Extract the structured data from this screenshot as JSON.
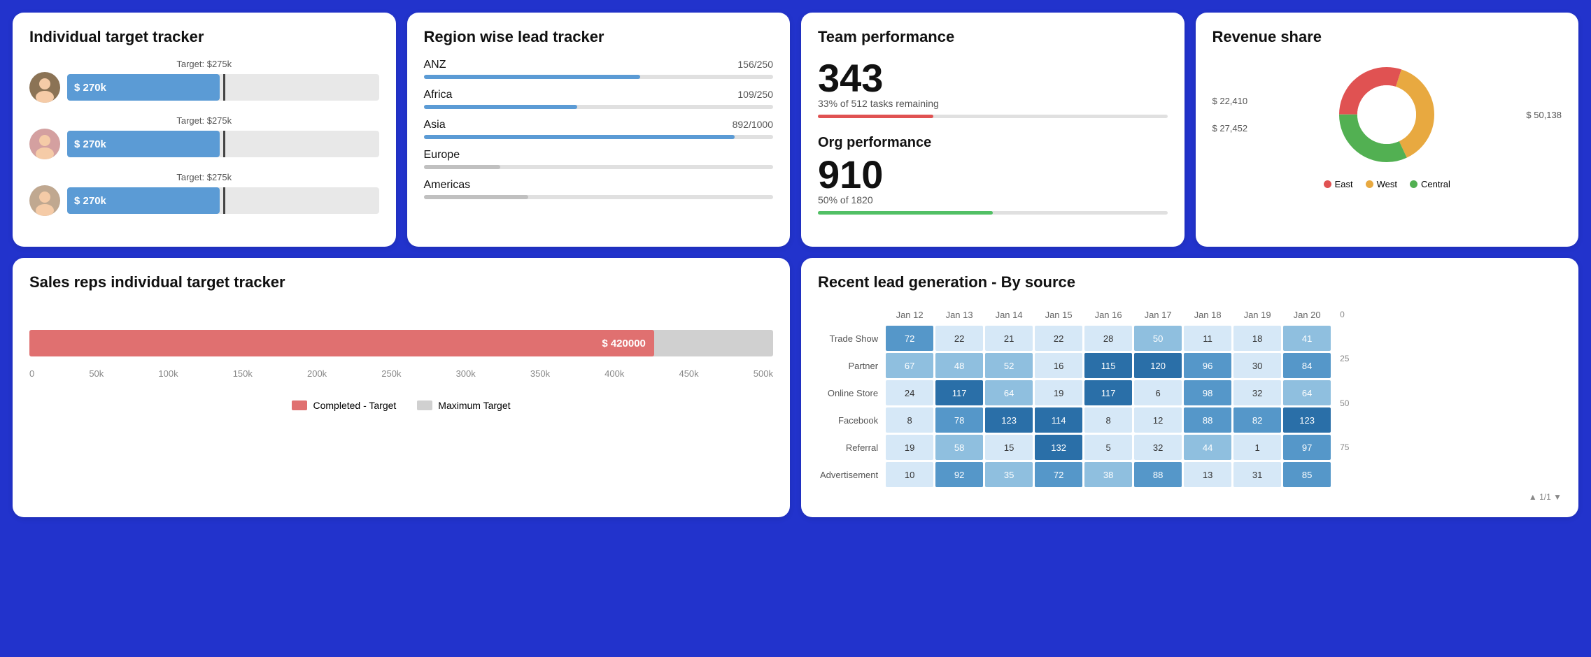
{
  "cards": {
    "individual_tracker": {
      "title": "Individual target tracker",
      "people": [
        {
          "id": 1,
          "label": "Target: $275k",
          "value": "$ 270k",
          "fill_pct": 49,
          "target_pct": 50
        },
        {
          "id": 2,
          "label": "Target: $275k",
          "value": "$ 270k",
          "fill_pct": 49,
          "target_pct": 50
        },
        {
          "id": 3,
          "label": "Target: $275k",
          "value": "$ 270k",
          "fill_pct": 49,
          "target_pct": 50
        }
      ]
    },
    "region_tracker": {
      "title": "Region wise lead tracker",
      "regions": [
        {
          "name": "ANZ",
          "current": 156,
          "total": 250,
          "pct": 62
        },
        {
          "name": "Africa",
          "current": 109,
          "total": 250,
          "pct": 44
        },
        {
          "name": "Asia",
          "current": 892,
          "total": 1000,
          "pct": 89
        },
        {
          "name": "Europe",
          "current": null,
          "total": null,
          "pct": 22
        },
        {
          "name": "Americas",
          "current": null,
          "total": null,
          "pct": 30
        }
      ]
    },
    "team_performance": {
      "title": "Team performance",
      "team_value": "343",
      "team_sub": "33% of 512 tasks remaining",
      "team_pct": 33,
      "org_title": "Org performance",
      "org_value": "910",
      "org_sub": "50% of 1820",
      "org_pct": 50
    },
    "revenue_share": {
      "title": "Revenue share",
      "labels_left": [
        "$ 22,410",
        "$ 27,452"
      ],
      "labels_right": [
        "$ 50,138"
      ],
      "segments": [
        {
          "label": "East",
          "color": "#e05252",
          "pct": 30
        },
        {
          "label": "West",
          "color": "#e8a940",
          "pct": 38
        },
        {
          "label": "Central",
          "color": "#52b052",
          "pct": 32
        }
      ]
    },
    "sales_tracker": {
      "title": "Sales reps individual target tracker",
      "bar_value": "$ 420000",
      "bar_fill_pct": 84,
      "axis_labels": [
        "0",
        "50k",
        "100k",
        "150k",
        "200k",
        "250k",
        "300k",
        "350k",
        "400k",
        "450k",
        "500k"
      ],
      "legend": [
        {
          "label": "Completed - Target",
          "color": "#e07070"
        },
        {
          "label": "Maximum Target",
          "color": "#d0d0d0"
        }
      ]
    },
    "lead_generation": {
      "title": "Recent lead generation - By source",
      "columns": [
        "Jan 12",
        "Jan 13",
        "Jan 14",
        "Jan 15",
        "Jan 16",
        "Jan 17",
        "Jan 18",
        "Jan 19",
        "Jan 20"
      ],
      "rows": [
        {
          "label": "Trade Show",
          "values": [
            72,
            22,
            21,
            22,
            28,
            50,
            11,
            18,
            41
          ]
        },
        {
          "label": "Partner",
          "values": [
            67,
            48,
            52,
            16,
            115,
            120,
            96,
            30,
            84
          ]
        },
        {
          "label": "Online Store",
          "values": [
            24,
            117,
            64,
            19,
            117,
            6,
            98,
            32,
            64
          ]
        },
        {
          "label": "Facebook",
          "values": [
            8,
            78,
            123,
            114,
            8,
            12,
            88,
            82,
            123
          ]
        },
        {
          "label": "Referral",
          "values": [
            19,
            58,
            15,
            132,
            5,
            32,
            44,
            1,
            97
          ]
        },
        {
          "label": "Advertisement",
          "values": [
            10,
            92,
            35,
            72,
            38,
            88,
            13,
            31,
            85
          ]
        }
      ],
      "right_axis": [
        "0",
        "25",
        "50",
        "75"
      ],
      "pagination": "1/1"
    }
  }
}
